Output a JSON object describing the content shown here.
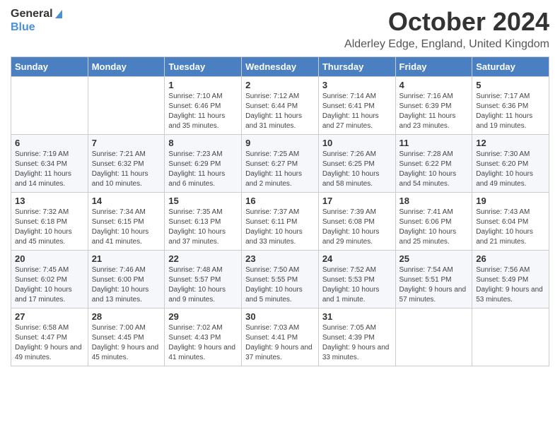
{
  "logo": {
    "line1": "General",
    "line2": "Blue"
  },
  "title": "October 2024",
  "location": "Alderley Edge, England, United Kingdom",
  "days_of_week": [
    "Sunday",
    "Monday",
    "Tuesday",
    "Wednesday",
    "Thursday",
    "Friday",
    "Saturday"
  ],
  "weeks": [
    [
      {
        "day": "",
        "info": ""
      },
      {
        "day": "",
        "info": ""
      },
      {
        "day": "1",
        "info": "Sunrise: 7:10 AM\nSunset: 6:46 PM\nDaylight: 11 hours and 35 minutes."
      },
      {
        "day": "2",
        "info": "Sunrise: 7:12 AM\nSunset: 6:44 PM\nDaylight: 11 hours and 31 minutes."
      },
      {
        "day": "3",
        "info": "Sunrise: 7:14 AM\nSunset: 6:41 PM\nDaylight: 11 hours and 27 minutes."
      },
      {
        "day": "4",
        "info": "Sunrise: 7:16 AM\nSunset: 6:39 PM\nDaylight: 11 hours and 23 minutes."
      },
      {
        "day": "5",
        "info": "Sunrise: 7:17 AM\nSunset: 6:36 PM\nDaylight: 11 hours and 19 minutes."
      }
    ],
    [
      {
        "day": "6",
        "info": "Sunrise: 7:19 AM\nSunset: 6:34 PM\nDaylight: 11 hours and 14 minutes."
      },
      {
        "day": "7",
        "info": "Sunrise: 7:21 AM\nSunset: 6:32 PM\nDaylight: 11 hours and 10 minutes."
      },
      {
        "day": "8",
        "info": "Sunrise: 7:23 AM\nSunset: 6:29 PM\nDaylight: 11 hours and 6 minutes."
      },
      {
        "day": "9",
        "info": "Sunrise: 7:25 AM\nSunset: 6:27 PM\nDaylight: 11 hours and 2 minutes."
      },
      {
        "day": "10",
        "info": "Sunrise: 7:26 AM\nSunset: 6:25 PM\nDaylight: 10 hours and 58 minutes."
      },
      {
        "day": "11",
        "info": "Sunrise: 7:28 AM\nSunset: 6:22 PM\nDaylight: 10 hours and 54 minutes."
      },
      {
        "day": "12",
        "info": "Sunrise: 7:30 AM\nSunset: 6:20 PM\nDaylight: 10 hours and 49 minutes."
      }
    ],
    [
      {
        "day": "13",
        "info": "Sunrise: 7:32 AM\nSunset: 6:18 PM\nDaylight: 10 hours and 45 minutes."
      },
      {
        "day": "14",
        "info": "Sunrise: 7:34 AM\nSunset: 6:15 PM\nDaylight: 10 hours and 41 minutes."
      },
      {
        "day": "15",
        "info": "Sunrise: 7:35 AM\nSunset: 6:13 PM\nDaylight: 10 hours and 37 minutes."
      },
      {
        "day": "16",
        "info": "Sunrise: 7:37 AM\nSunset: 6:11 PM\nDaylight: 10 hours and 33 minutes."
      },
      {
        "day": "17",
        "info": "Sunrise: 7:39 AM\nSunset: 6:08 PM\nDaylight: 10 hours and 29 minutes."
      },
      {
        "day": "18",
        "info": "Sunrise: 7:41 AM\nSunset: 6:06 PM\nDaylight: 10 hours and 25 minutes."
      },
      {
        "day": "19",
        "info": "Sunrise: 7:43 AM\nSunset: 6:04 PM\nDaylight: 10 hours and 21 minutes."
      }
    ],
    [
      {
        "day": "20",
        "info": "Sunrise: 7:45 AM\nSunset: 6:02 PM\nDaylight: 10 hours and 17 minutes."
      },
      {
        "day": "21",
        "info": "Sunrise: 7:46 AM\nSunset: 6:00 PM\nDaylight: 10 hours and 13 minutes."
      },
      {
        "day": "22",
        "info": "Sunrise: 7:48 AM\nSunset: 5:57 PM\nDaylight: 10 hours and 9 minutes."
      },
      {
        "day": "23",
        "info": "Sunrise: 7:50 AM\nSunset: 5:55 PM\nDaylight: 10 hours and 5 minutes."
      },
      {
        "day": "24",
        "info": "Sunrise: 7:52 AM\nSunset: 5:53 PM\nDaylight: 10 hours and 1 minute."
      },
      {
        "day": "25",
        "info": "Sunrise: 7:54 AM\nSunset: 5:51 PM\nDaylight: 9 hours and 57 minutes."
      },
      {
        "day": "26",
        "info": "Sunrise: 7:56 AM\nSunset: 5:49 PM\nDaylight: 9 hours and 53 minutes."
      }
    ],
    [
      {
        "day": "27",
        "info": "Sunrise: 6:58 AM\nSunset: 4:47 PM\nDaylight: 9 hours and 49 minutes."
      },
      {
        "day": "28",
        "info": "Sunrise: 7:00 AM\nSunset: 4:45 PM\nDaylight: 9 hours and 45 minutes."
      },
      {
        "day": "29",
        "info": "Sunrise: 7:02 AM\nSunset: 4:43 PM\nDaylight: 9 hours and 41 minutes."
      },
      {
        "day": "30",
        "info": "Sunrise: 7:03 AM\nSunset: 4:41 PM\nDaylight: 9 hours and 37 minutes."
      },
      {
        "day": "31",
        "info": "Sunrise: 7:05 AM\nSunset: 4:39 PM\nDaylight: 9 hours and 33 minutes."
      },
      {
        "day": "",
        "info": ""
      },
      {
        "day": "",
        "info": ""
      }
    ]
  ]
}
